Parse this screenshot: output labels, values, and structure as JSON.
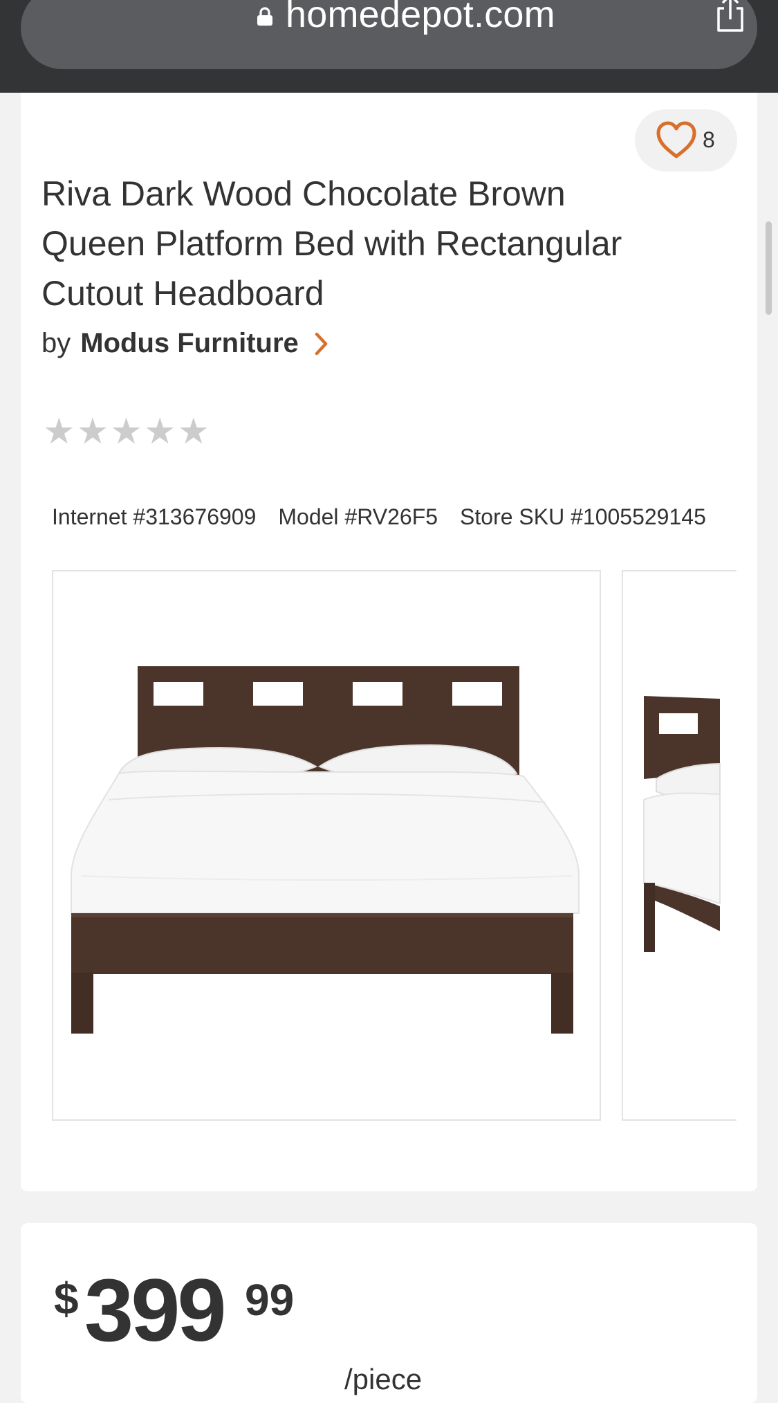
{
  "browser": {
    "url": "homedepot.com",
    "lock_icon": "lock-icon",
    "share_icon": "share-icon"
  },
  "favorite": {
    "icon": "heart-icon",
    "count": "8",
    "accent_color": "#d86f2a"
  },
  "product": {
    "title": "Riva Dark Wood Chocolate Brown Queen Platform Bed with Rectangular Cutout Headboard",
    "brand_prefix": "by",
    "brand_name": "Modus Furniture",
    "brand_chevron_icon": "chevron-right-icon",
    "rating": {
      "stars_filled": 0,
      "stars_total": 5,
      "star_glyph": "★",
      "star_color": "#cccccc"
    },
    "identifiers": {
      "internet": "Internet #313676909",
      "model": "Model #RV26F5",
      "store_sku": "Store SKU #1005529145"
    },
    "images": [
      {
        "name": "bed-front-image"
      },
      {
        "name": "bed-angle-image"
      }
    ]
  },
  "price": {
    "currency": "$",
    "dollars": "399",
    "cents": "99",
    "unit": "/piece"
  }
}
